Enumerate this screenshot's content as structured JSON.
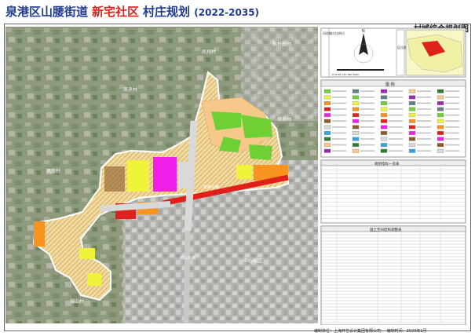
{
  "header": {
    "title_prefix": "泉港区山腰街道",
    "title_highlight": "新宅社区",
    "title_suffix": "村庄规划",
    "years": "(2022-2035)",
    "subtitle": "村域综合规划图"
  },
  "map": {
    "places": [
      "狄杆庭村",
      "凤翔村",
      "凤来村",
      "凤南村",
      "樟泉村",
      "中心城区",
      "瑞山村"
    ],
    "roads": [
      "宏峰中路",
      "南山北路"
    ]
  },
  "side_panel": {
    "compass_label": "N",
    "title_boxes": [
      "风玫瑰与比例尺",
      "区位图"
    ],
    "scale_label": "0   20   60   120   180   300m",
    "legend_title": "图    例",
    "table1_title": "规划指标一览表",
    "table2_title": "国土空间结构调整表"
  },
  "footer": {
    "org": "编制单位：上海开艺设计集团有限公司",
    "date": "编制时间：2023年1月"
  }
}
